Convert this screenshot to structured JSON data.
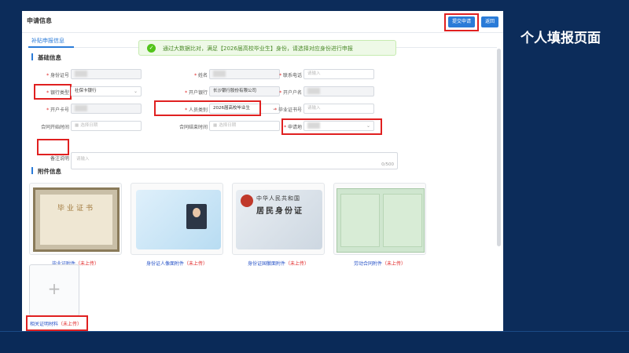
{
  "slide": {
    "title": "个人填报页面"
  },
  "window": {
    "title": "申请信息",
    "submit_label": "提交申请",
    "back_label": "返回",
    "tab_label": "补贴申报信息"
  },
  "toast": {
    "text": "通过大数据比对，满足【2026届高校毕业生】身份，请选择对应身份进行申报"
  },
  "basic": {
    "heading": "基础信息",
    "id_number_label": "身份证号",
    "name_label": "姓名",
    "phone_label": "联系电话",
    "phone_placeholder": "请输入",
    "bank_type_label": "银行类型",
    "bank_type_value": "社保卡银行",
    "bank_label": "开户银行",
    "bank_value": "长沙银行股份有限公司",
    "account_name_label": "开户户名",
    "card_label": "开户卡号",
    "person_type_label": "人员类别",
    "person_type_value": "2026届高校毕业生",
    "cert_no_label": "毕业证书号",
    "cert_no_placeholder": "请输入",
    "contract_start_label": "合同开始时间",
    "contract_start_placeholder": "选择日期",
    "contract_end_label": "合同结束时间",
    "contract_end_placeholder": "选择日期",
    "apply_place_label": "申请地",
    "remark_label": "备注说明",
    "remark_placeholder": "请输入",
    "remark_count": "0/500"
  },
  "attachments": {
    "heading": "附件信息",
    "items": [
      {
        "label": "毕业证附件",
        "status": "（未上传）"
      },
      {
        "label": "身份证人像面附件",
        "status": "（未上传）"
      },
      {
        "label": "身份证国徽面附件",
        "status": "（未上传）"
      },
      {
        "label": "劳动合同附件",
        "status": "（未上传）"
      }
    ],
    "upload_symbol": "+",
    "extra_label": "相关证明材料",
    "extra_status": "（未上传）"
  },
  "samples": {
    "diploma_text": "毕业证书",
    "idback_line1": "中华人民共和国",
    "idback_line2": "居民身份证"
  },
  "colors": {
    "accent": "#2a7bd8",
    "highlight": "#e02020",
    "background": "#0c2c5a",
    "success": "#52c41a"
  }
}
